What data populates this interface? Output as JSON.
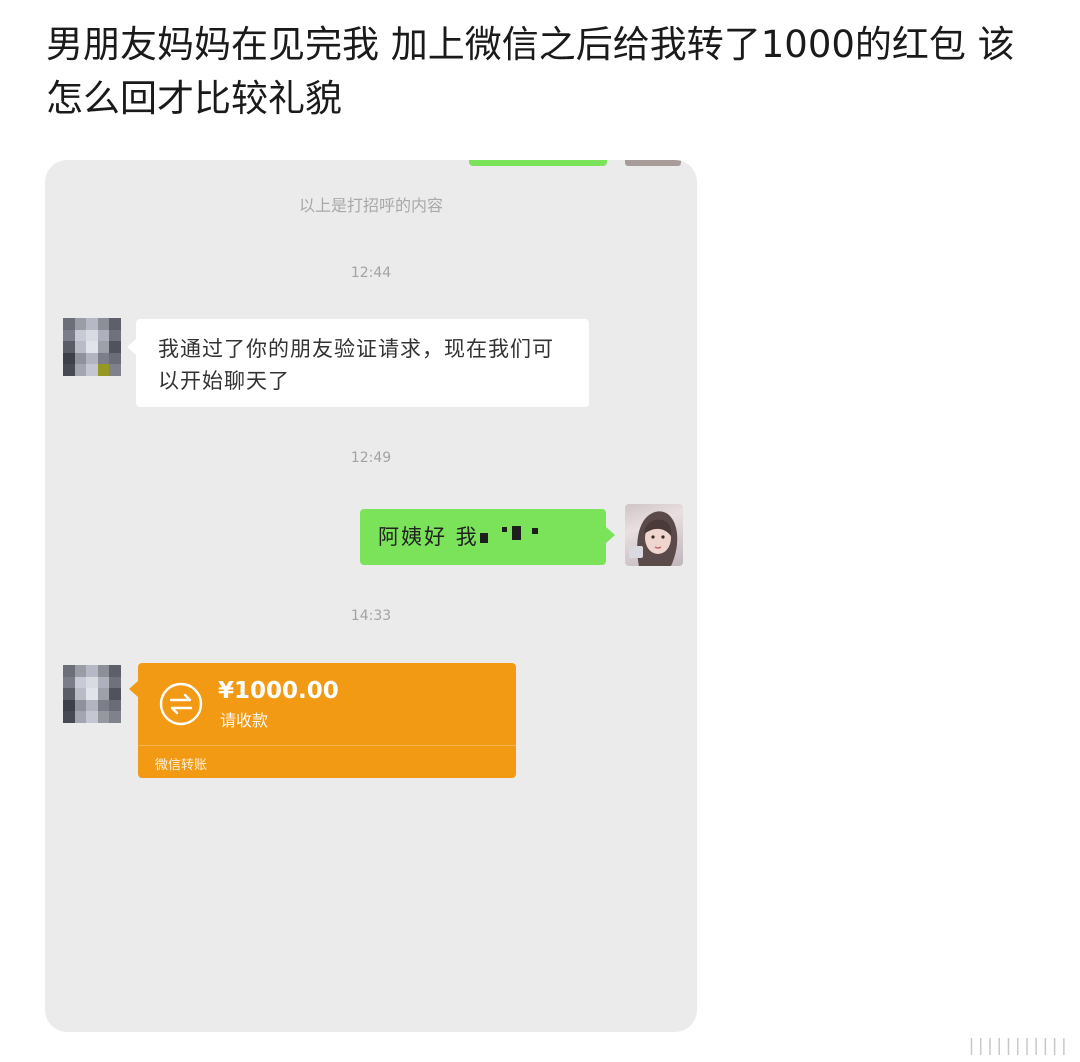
{
  "post": {
    "title": "男朋友妈妈在见完我 加上微信之后给我转了1000的红包 该怎么回才比较礼貌"
  },
  "chat": {
    "system_note": "以上是打招呼的内容",
    "timestamps": [
      "12:44",
      "12:49",
      "14:33"
    ],
    "incoming_message": "我通过了你的朋友验证请求，现在我们可以开始聊天了",
    "outgoing_message": "阿姨好 我",
    "transfer": {
      "amount": "¥1000.00",
      "status": "请收款",
      "label": "微信转账",
      "icon": "transfer-arrows-icon"
    }
  },
  "colors": {
    "chat_background": "#ebebeb",
    "outgoing_bubble": "#7be35a",
    "incoming_bubble": "#ffffff",
    "transfer_card": "#f39a14"
  },
  "watermark": {
    "text": "|||||||||||"
  }
}
